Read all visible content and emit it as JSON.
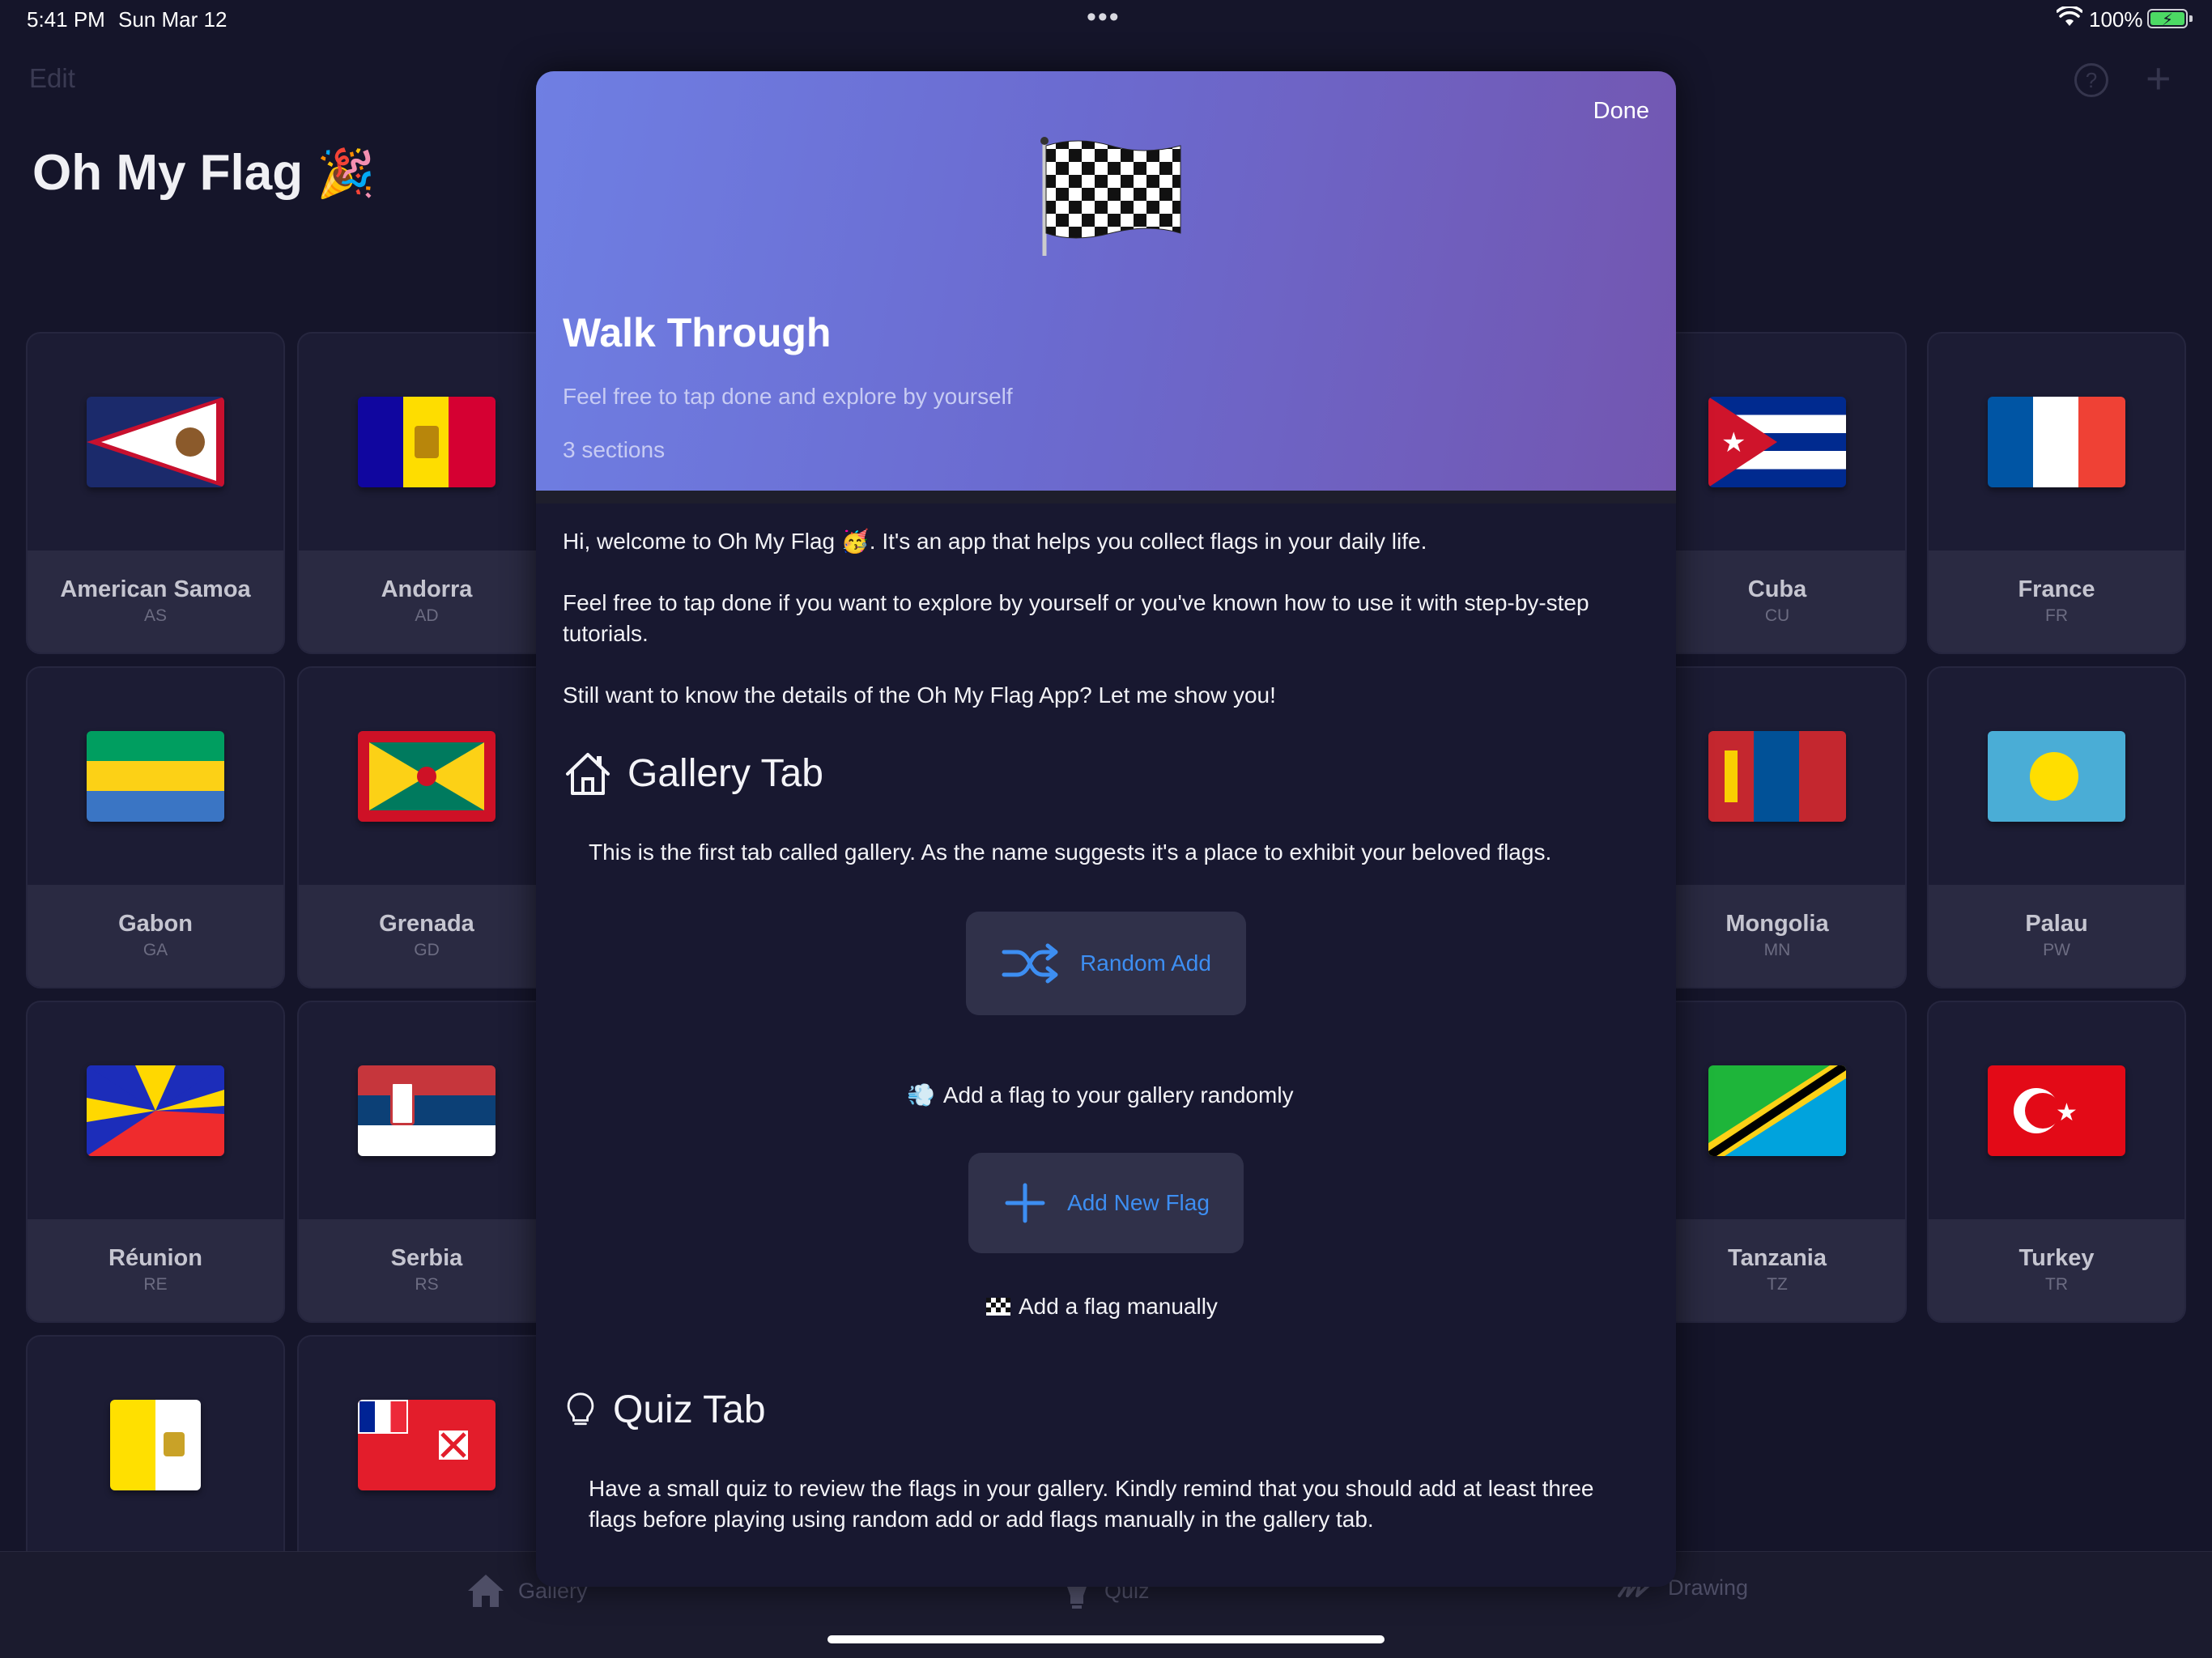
{
  "status_bar": {
    "time": "5:41 PM",
    "date": "Sun Mar 12",
    "dots": "•••",
    "battery_pct": "100%"
  },
  "app": {
    "edit_label": "Edit",
    "help_icon": "?",
    "add_icon": "+",
    "title": "Oh My Flag",
    "title_emoji": "🎉"
  },
  "flags": [
    {
      "name": "American Samoa",
      "code": "AS"
    },
    {
      "name": "Andorra",
      "code": "AD"
    },
    {
      "name": "Cuba",
      "code": "CU"
    },
    {
      "name": "France",
      "code": "FR"
    },
    {
      "name": "Gabon",
      "code": "GA"
    },
    {
      "name": "Grenada",
      "code": "GD"
    },
    {
      "name": "Mongolia",
      "code": "MN"
    },
    {
      "name": "Palau",
      "code": "PW"
    },
    {
      "name": "Réunion",
      "code": "RE"
    },
    {
      "name": "Serbia",
      "code": "RS"
    },
    {
      "name": "Tanzania",
      "code": "TZ"
    },
    {
      "name": "Turkey",
      "code": "TR"
    }
  ],
  "tabs": [
    {
      "label": "Gallery",
      "icon": "house-icon"
    },
    {
      "label": "Quiz",
      "icon": "lightbulb-icon"
    },
    {
      "label": "Drawing",
      "icon": "scribble-icon"
    }
  ],
  "sheet": {
    "done_label": "Done",
    "title": "Walk Through",
    "subtitle": "Feel free to tap done and explore by yourself",
    "sections_count": "3 sections",
    "intro_1_a": "Hi, welcome to Oh My Flag",
    "intro_1_emoji": "🥳",
    "intro_1_b": ". It's an app that helps you collect flags in your daily life.",
    "intro_2": "Feel free to tap done if you want to explore by yourself or you've known how to use it with step-by-step tutorials.",
    "intro_3": "Still want to know the details of the Oh My Flag App? Let me show you!",
    "gallery_heading": "Gallery Tab",
    "gallery_desc": "This is the first tab called gallery. As the name suggests it's a place to exhibit your beloved flags.",
    "random_add_label": "Random Add",
    "random_add_caption_emoji": "💨",
    "random_add_caption": "Add a flag to your gallery randomly",
    "add_new_label": "Add New Flag",
    "add_new_caption": "Add a flag manually",
    "quiz_heading": "Quiz Tab",
    "quiz_desc": "Have a small quiz to review the flags in your gallery. Kindly remind that you should add at least three flags before playing using random add or add flags manually in the gallery tab."
  },
  "colors": {
    "accent": "#3d8ef2",
    "header_start": "#6f7fe3",
    "header_end": "#7356b0",
    "background": "#15152a"
  }
}
